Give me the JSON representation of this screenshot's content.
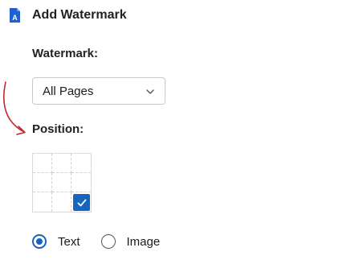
{
  "header": {
    "title": "Add Watermark",
    "icon": "app-document-icon"
  },
  "watermark": {
    "label": "Watermark:",
    "selected": "All Pages"
  },
  "position": {
    "label": "Position:",
    "selected_cell": "bottom-right"
  },
  "content_type": {
    "options": [
      {
        "label": "Text",
        "checked": true
      },
      {
        "label": "Image",
        "checked": false
      }
    ]
  },
  "colors": {
    "accent": "#1565c0",
    "annotation_arrow": "#c62828"
  }
}
